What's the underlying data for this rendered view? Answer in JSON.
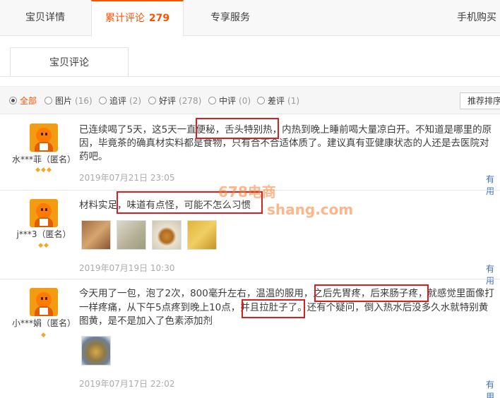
{
  "tabs": [
    {
      "label": "宝贝详情"
    },
    {
      "label": "累计评论",
      "count": "279"
    },
    {
      "label": "专享服务"
    },
    {
      "label": "手机购买"
    }
  ],
  "subtab": {
    "label": "宝贝评论"
  },
  "filters": [
    {
      "label": "全部",
      "count": ""
    },
    {
      "label": "图片",
      "count": "(16)"
    },
    {
      "label": "追评",
      "count": "(2)"
    },
    {
      "label": "好评",
      "count": "(278)"
    },
    {
      "label": "中评",
      "count": "(0)"
    },
    {
      "label": "差评",
      "count": "(1)"
    }
  ],
  "sort_label": "推荐排序",
  "reviews": [
    {
      "user": "水***菲（匿名）",
      "line1": "已连续喝了5天，这5天一直便秘，舌头特别热，内热到晚上睡前喝大量凉白开。不知道是哪里的原",
      "line2": "因，毕竟茶的确真材实料都是食物，只有合不合适体质了。建议真有亚健康状态的人还是去医院对",
      "line3": "药吧。",
      "date": "2019年07月21日 23:05",
      "useful": "有用"
    },
    {
      "user": "j***3（匿名）",
      "line1": "材料实足，味道有点怪，可能不怎么习惯",
      "date": "2019年07月19日 10:30",
      "useful": "有用"
    },
    {
      "user": "小***娟（匿名）",
      "line1": "今天用了一包，泡了2次，800毫升左右，温温的服用，之后先胃疼，后来肠子疼，就感觉里面像打",
      "line2": "一样疼痛，从下午5点疼到晚上10点，并且拉肚子了。还有个疑问，倒入热水后没多久水就特别黄",
      "line3": "图黄，是不是加入了色素添加剂",
      "date": "2019年07月17日 22:02",
      "useful": "有用"
    }
  ],
  "watermark": {
    "line1": "678电商",
    "line2": "shang.com"
  },
  "colors": {
    "accent": "#ff5000",
    "highlight": "#d81e1e",
    "link": "#3c6fb0"
  }
}
